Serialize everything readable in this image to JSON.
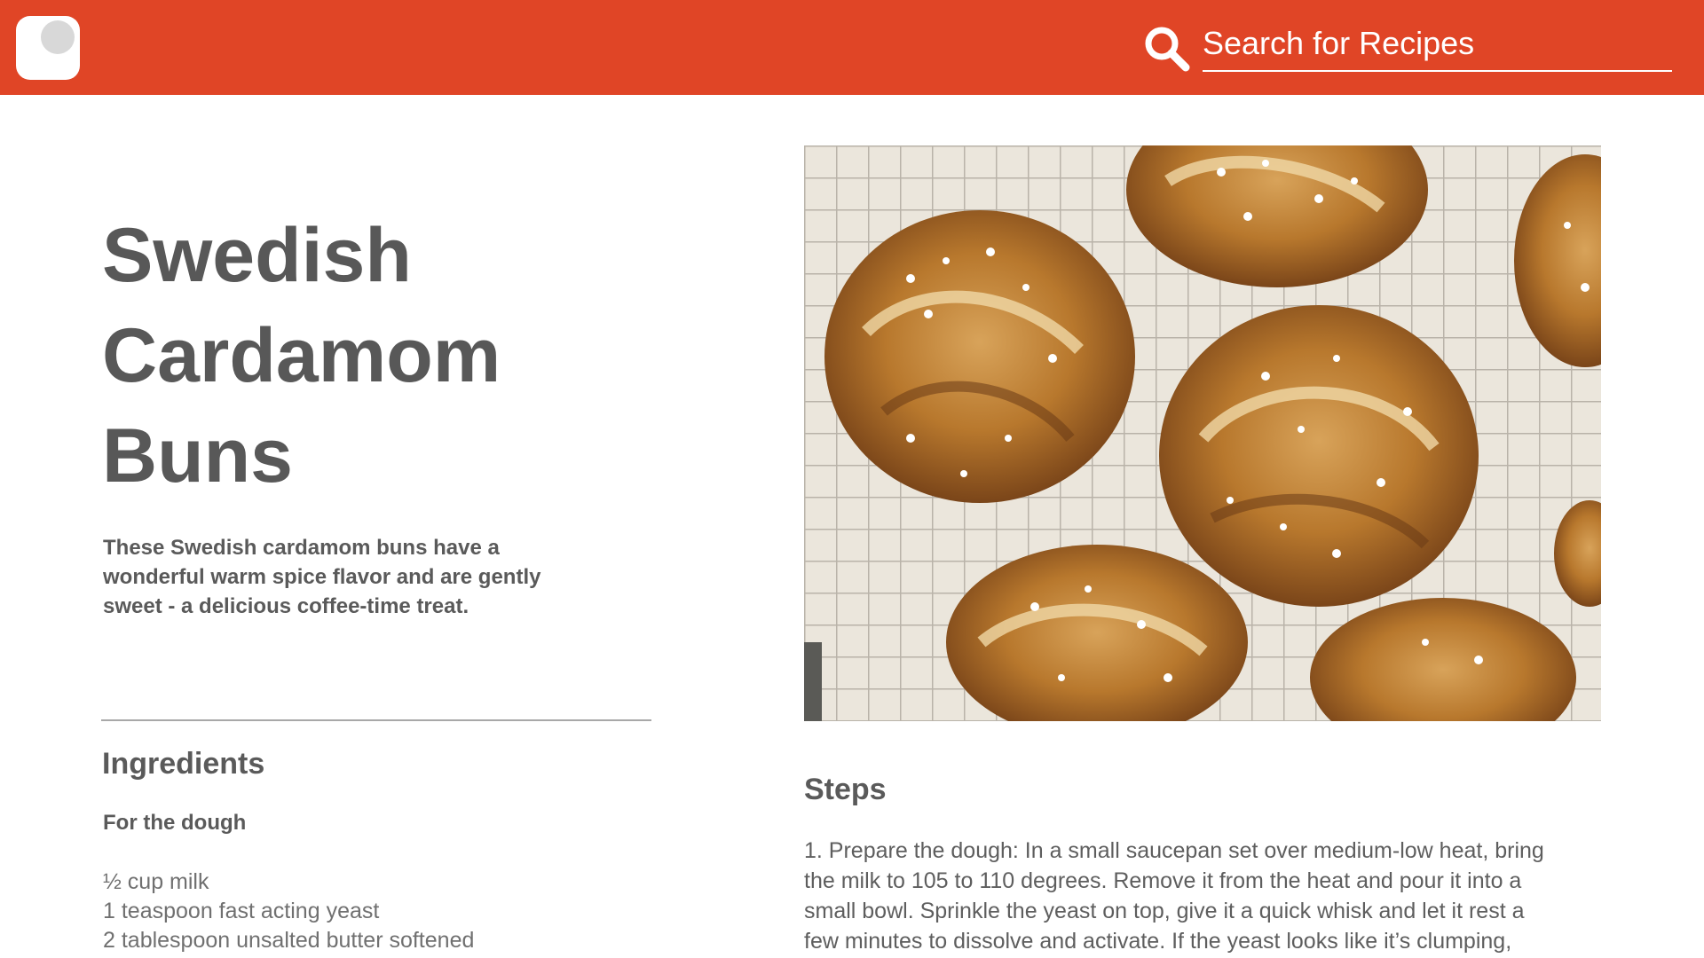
{
  "header": {
    "background_color": "#e04526",
    "logo_icon": "app-logo-icon",
    "search_icon": "search-icon",
    "search_placeholder": "Search for Recipes"
  },
  "recipe": {
    "title": "Swedish Cardamom Buns",
    "description": "These Swedish cardamom buns have a wonderful warm spice flavor and are gently sweet - a delicious coffee-time treat.",
    "image_description": "cardamom buns on cooling rack",
    "ingredients": {
      "heading": "Ingredients",
      "groups": [
        {
          "name": "For the dough",
          "items": [
            "½ cup milk",
            "1 teaspoon fast acting yeast",
            "2 tablespoon unsalted butter softened"
          ]
        }
      ]
    },
    "steps": {
      "heading": "Steps",
      "items": [
        "1. Prepare the dough: In a small saucepan set over medium-low heat, bring the milk to 105 to 110 degrees. Remove it from the heat and pour it into a small bowl. Sprinkle the yeast on top, give it a quick whisk and let it rest a few minutes to dissolve and activate. If the yeast looks like it’s clumping,"
      ]
    }
  }
}
